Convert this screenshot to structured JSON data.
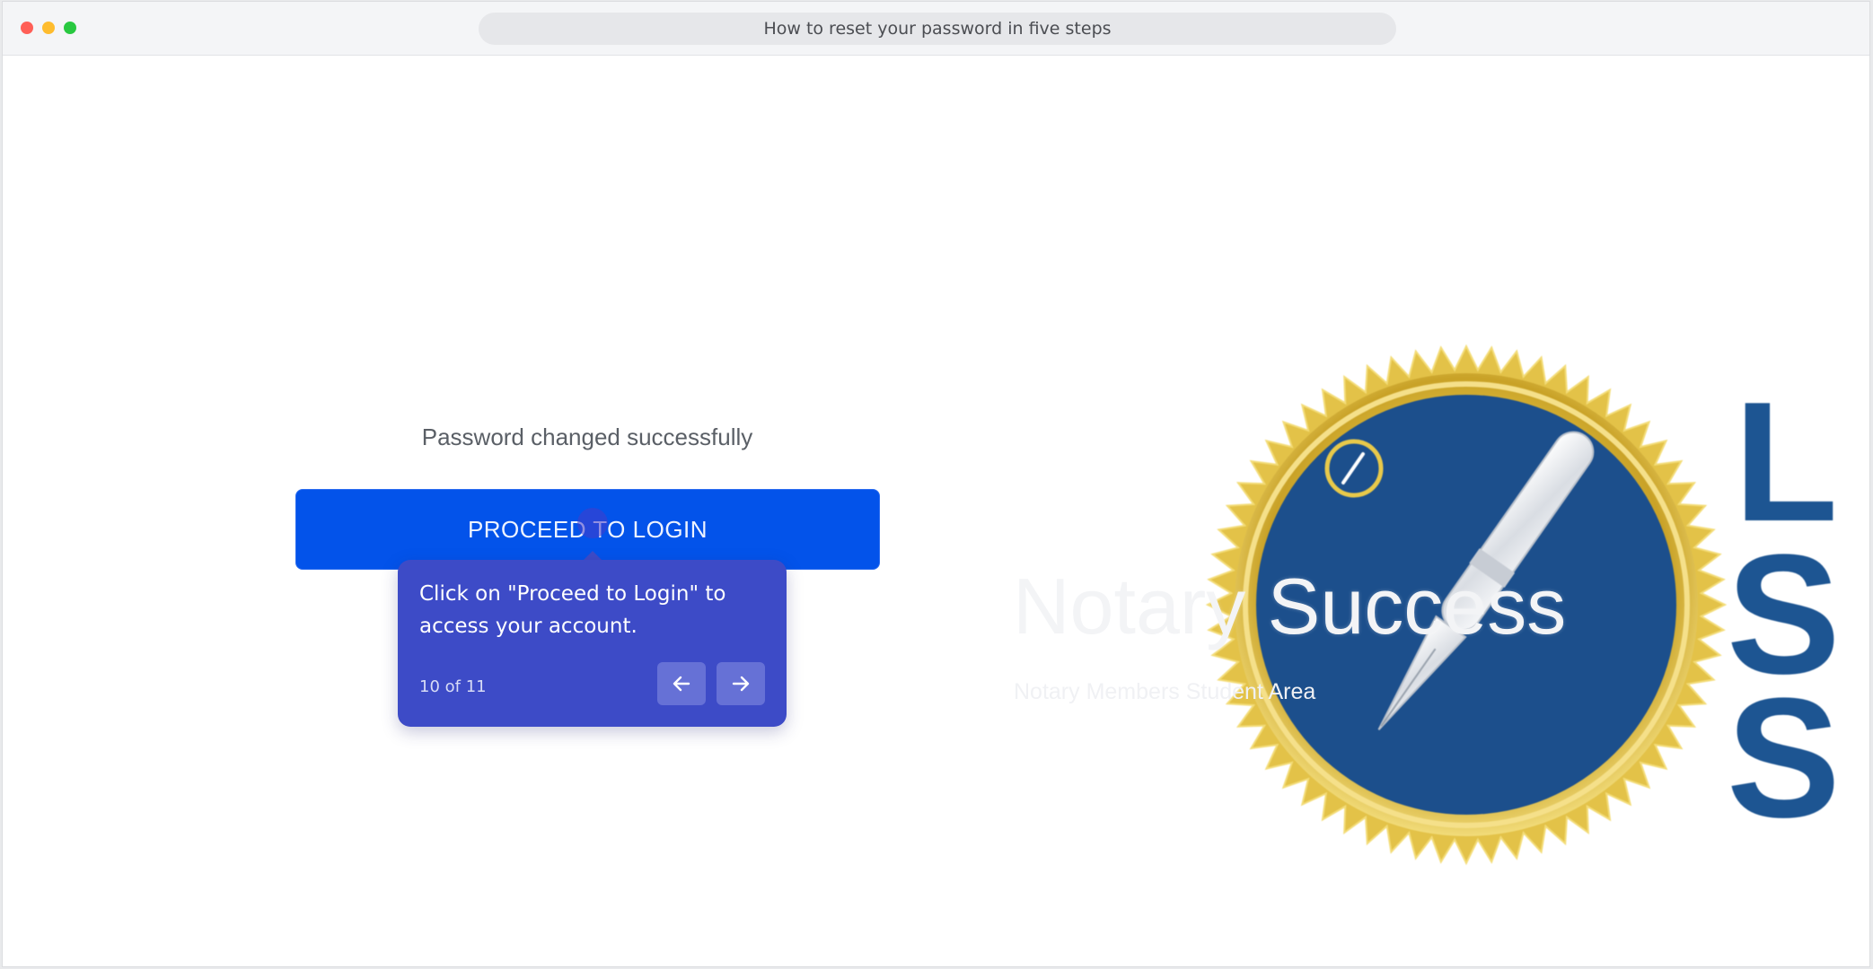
{
  "window": {
    "title": "How to reset your password in five steps"
  },
  "page": {
    "success_message": "Password changed successfully",
    "proceed_button_label": "PROCEED TO LOGIN"
  },
  "tooltip": {
    "text": "Click on \"Proceed to Login\" to access your account.",
    "step_indicator": "10 of 11",
    "prev_icon": "arrow-left-icon",
    "next_icon": "arrow-right-icon"
  },
  "logo": {
    "title": "Notary Success",
    "subtitle": "Notary Members Student Area",
    "side_letters": [
      "L",
      "S",
      "S"
    ],
    "colors": {
      "seal_gold": "#e8c94a",
      "seal_blue": "#1c4f8c",
      "side_text_blue": "#1d5592"
    }
  },
  "colors": {
    "primary_button": "#0353ea",
    "tooltip_bg": "#3d4bc7",
    "nav_button_bg": "#6671d6"
  }
}
